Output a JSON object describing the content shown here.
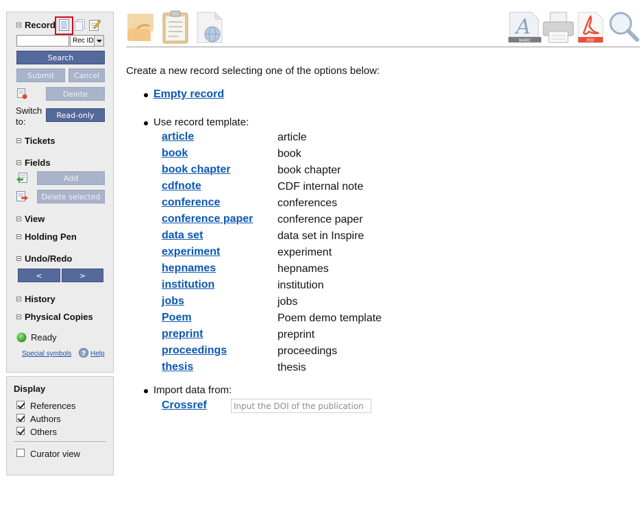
{
  "sidebar": {
    "record_title": "Record",
    "recid_select": "Rec ID",
    "search_label": "Search",
    "submit_label": "Submit",
    "cancel_label": "Cancel",
    "delete_label": "Delete",
    "switch_to": "Switch to:",
    "readonly_label": "Read-only",
    "tickets_title": "Tickets",
    "fields_title": "Fields",
    "add_label": "Add",
    "delete_selected_label": "Delete selected",
    "view_title": "View",
    "holding_pen_title": "Holding Pen",
    "undo_redo_title": "Undo/Redo",
    "undo_label": "<",
    "redo_label": ">",
    "history_title": "History",
    "physical_copies_title": "Physical Copies",
    "status_text": "Ready",
    "special_symbols": "Special symbols",
    "help": "Help"
  },
  "display": {
    "title": "Display",
    "options": [
      {
        "label": "References",
        "checked": true
      },
      {
        "label": "Authors",
        "checked": true
      },
      {
        "label": "Others",
        "checked": true
      }
    ],
    "curator_view": {
      "label": "Curator view",
      "checked": false
    }
  },
  "toolbar": {
    "marc_badge": "MARC",
    "pdf_badge": "PDF"
  },
  "main": {
    "intro": "Create a new record selecting one of the options below:",
    "empty_record": "Empty record",
    "use_template": "Use record template:",
    "templates": [
      {
        "name": "article",
        "desc": "article"
      },
      {
        "name": "book",
        "desc": "book"
      },
      {
        "name": "book chapter",
        "desc": "book chapter"
      },
      {
        "name": "cdfnote",
        "desc": "CDF internal note"
      },
      {
        "name": "conference",
        "desc": "conferences"
      },
      {
        "name": "conference paper",
        "desc": "conference paper"
      },
      {
        "name": "data set",
        "desc": "data set in Inspire"
      },
      {
        "name": "experiment",
        "desc": "experiment"
      },
      {
        "name": "hepnames",
        "desc": "hepnames"
      },
      {
        "name": "institution",
        "desc": "institution"
      },
      {
        "name": "jobs",
        "desc": "jobs"
      },
      {
        "name": "Poem",
        "desc": "Poem demo template"
      },
      {
        "name": "preprint",
        "desc": "preprint"
      },
      {
        "name": "proceedings",
        "desc": "proceedings"
      },
      {
        "name": "thesis",
        "desc": "thesis"
      }
    ],
    "import_from": "Import data from:",
    "crossref": "Crossref",
    "doi_placeholder": "Input the DOI of the publication"
  },
  "colors": {
    "button_active": "#56699b",
    "button_disabled": "#a9b3c9",
    "link": "#0b57b4",
    "highlight_box": "#e0001b",
    "status_green": "#3aa832"
  }
}
